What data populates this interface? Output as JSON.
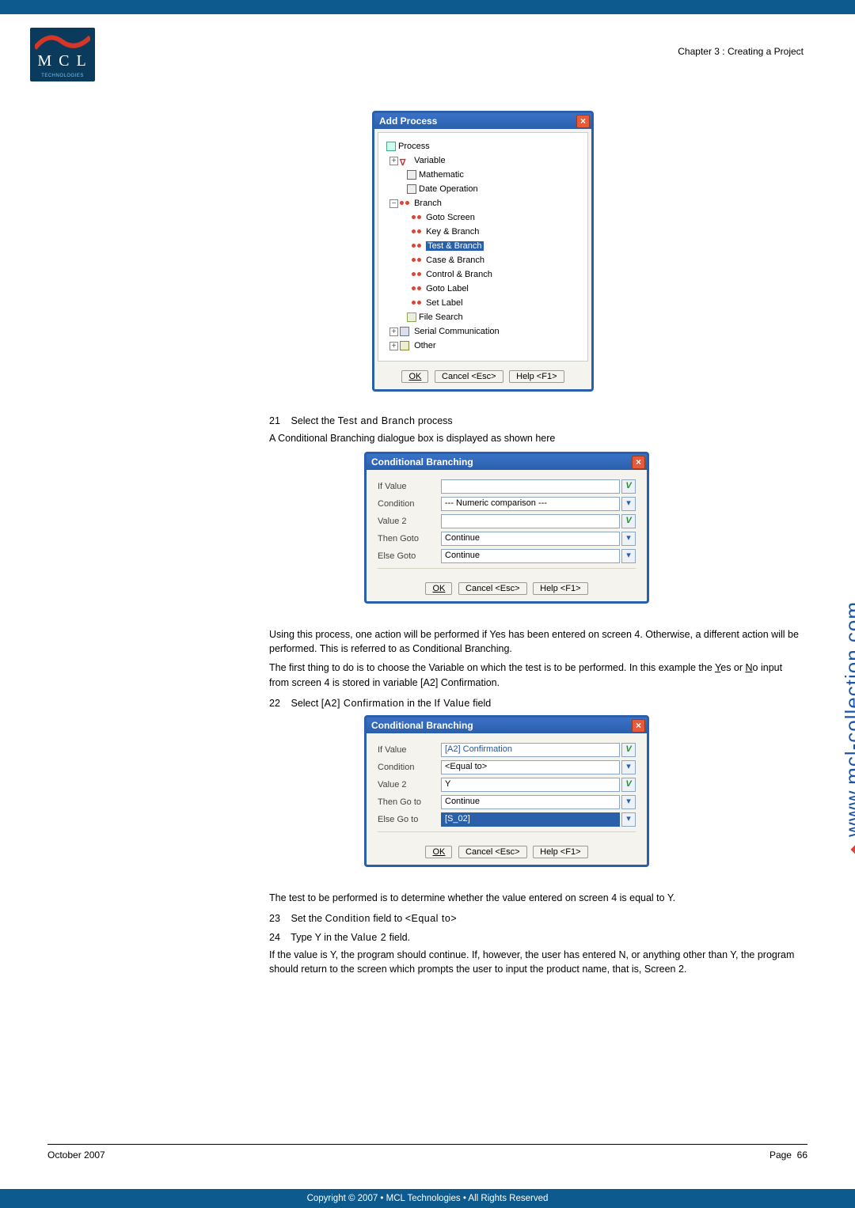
{
  "chapter": "Chapter 3 : Creating a Project",
  "logo_text": "M C L",
  "logo_sub": "TECHNOLOGIES",
  "dialog_add": {
    "title": "Add Process",
    "tree": {
      "root": "Process",
      "variable": "Variable",
      "mathematic": "Mathematic",
      "date_op": "Date Operation",
      "branch": "Branch",
      "items": [
        "Goto Screen",
        "Key & Branch",
        "Test & Branch",
        "Case & Branch",
        "Control & Branch",
        "Goto Label",
        "Set Label"
      ],
      "file_search": "File Search",
      "serial": "Serial Communication",
      "other": "Other"
    },
    "buttons": {
      "ok": "OK",
      "cancel": "Cancel <Esc>",
      "help": "Help <F1>"
    }
  },
  "step21_num": "21",
  "step21_text_a": "Select the ",
  "step21_text_b": "Test and Branch",
  "step21_text_c": " process",
  "after21": "A Conditional Branching dialogue box is displayed as shown here",
  "dialog_cb": {
    "title": "Conditional Branching",
    "labels": {
      "ifvalue": "If Value",
      "condition": "Condition",
      "value2": "Value 2",
      "then": "Then Goto",
      "else": "Else Goto",
      "then2": "Then Go to",
      "else2": "Else Go to"
    },
    "cb1": {
      "condition": "--- Numeric comparison ---",
      "then": "Continue",
      "else": "Continue"
    },
    "cb2": {
      "ifvalue": "[A2] Confirmation",
      "condition": "<Equal to>",
      "value2": "Y",
      "then": "Continue",
      "else": "[S_02]"
    },
    "buttons": {
      "ok": "OK",
      "cancel": "Cancel <Esc>",
      "help": "Help <F1>"
    }
  },
  "para1": "Using this process, one action will be performed if Yes has been entered on screen 4. Otherwise, a different action will be performed. This is referred to as Conditional Branching.",
  "para2_a": "The first thing to do is to choose the Variable on which the test is to be performed. In this example the ",
  "para2_y": "Y",
  "para2_b": "es or ",
  "para2_n": "N",
  "para2_c": "o input from screen 4 is stored in variable [A2] Confirmation.",
  "step22_num": "22",
  "step22_a": "Select ",
  "step22_b": "[A2] Confirmation",
  "step22_c": " in the ",
  "step22_d": "If Value",
  "step22_e": " field",
  "para3": "The test to be performed is to determine whether the value entered on screen 4 is equal to Y.",
  "step23_num": "23",
  "step23_a": "Set the ",
  "step23_b": "Condition",
  "step23_c": " field to ",
  "step23_d": "<Equal to>",
  "step24_num": "24",
  "step24_a": "Type Y in the ",
  "step24_b": "Value 2",
  "step24_c": " field.",
  "para4": "If the value is Y, the program should continue. If, however, the user has entered N, or anything other than Y, the program should return to the screen which prompts the user to input the product name, that is, Screen 2.",
  "side_url": "www.mcl-collection.com",
  "footer_date": "October 2007",
  "footer_page_label": "Page",
  "footer_page_num": "66",
  "copyright": "Copyright © 2007 • MCL Technologies • All Rights Reserved"
}
